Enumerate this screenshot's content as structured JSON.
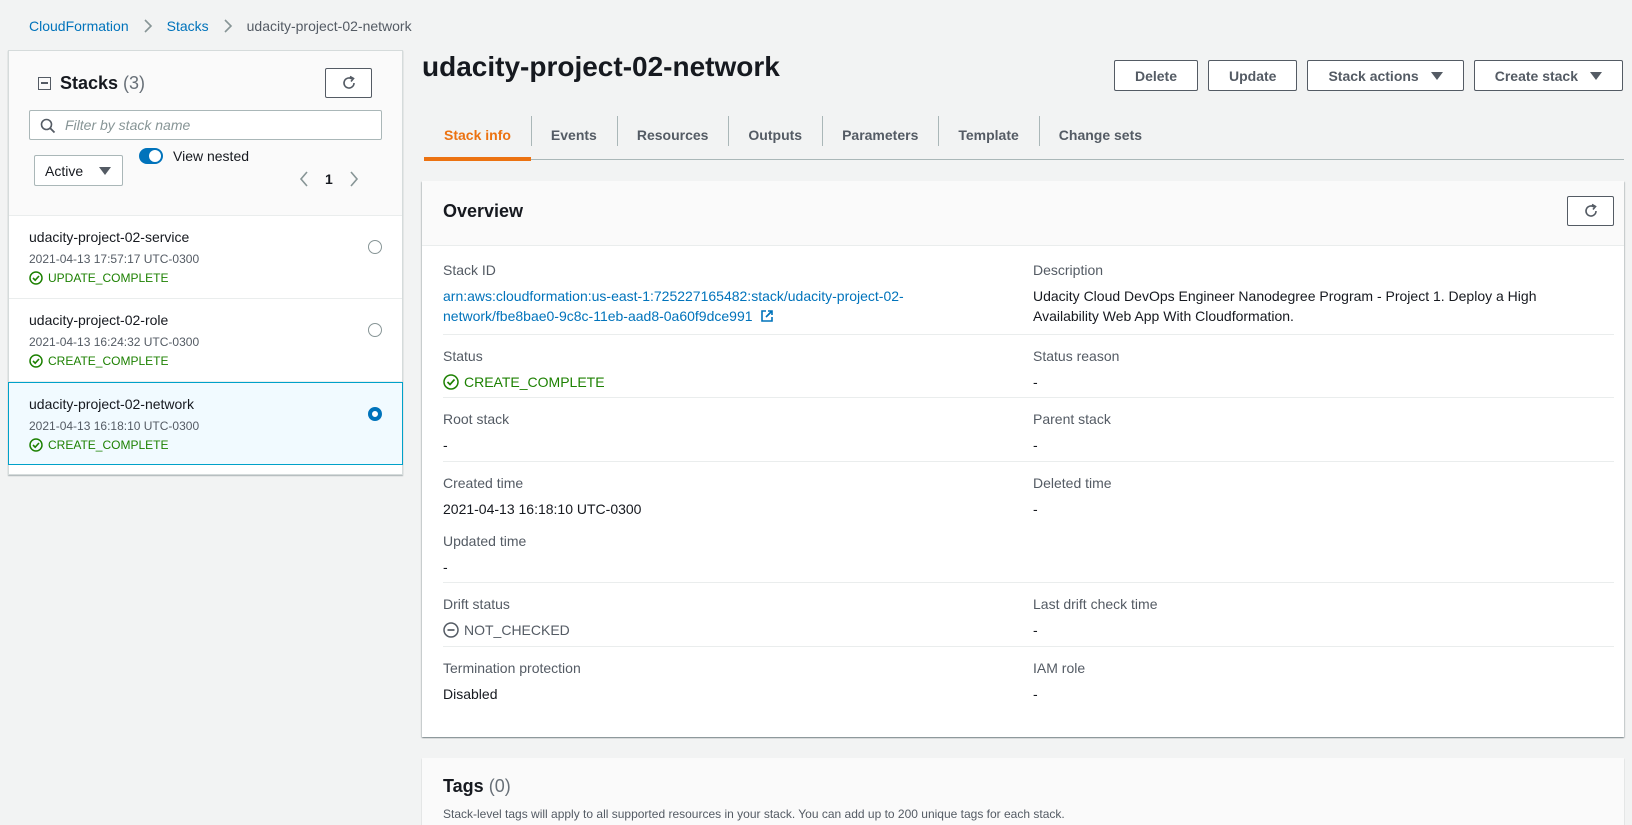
{
  "breadcrumb": {
    "root": "CloudFormation",
    "stacks": "Stacks",
    "current": "udacity-project-02-network"
  },
  "sidebar": {
    "title": "Stacks",
    "count": "(3)",
    "search_placeholder": "Filter by stack name",
    "filter_value": "Active",
    "view_nested_label": "View nested",
    "page": "1",
    "stacks": [
      {
        "name": "udacity-project-02-service",
        "date": "2021-04-13 17:57:17 UTC-0300",
        "status": "UPDATE_COMPLETE",
        "selected": false
      },
      {
        "name": "udacity-project-02-role",
        "date": "2021-04-13 16:24:32 UTC-0300",
        "status": "CREATE_COMPLETE",
        "selected": false
      },
      {
        "name": "udacity-project-02-network",
        "date": "2021-04-13 16:18:10 UTC-0300",
        "status": "CREATE_COMPLETE",
        "selected": true
      }
    ]
  },
  "main": {
    "title": "udacity-project-02-network",
    "actions": {
      "delete": "Delete",
      "update": "Update",
      "stack_actions": "Stack actions",
      "create_stack": "Create stack"
    },
    "tabs": [
      "Stack info",
      "Events",
      "Resources",
      "Outputs",
      "Parameters",
      "Template",
      "Change sets"
    ],
    "active_tab": "Stack info"
  },
  "overview": {
    "title": "Overview",
    "stack_id_label": "Stack ID",
    "stack_id_line1": "arn:aws:cloudformation:us-east-1:725227165482:stack/udacity-project-02-",
    "stack_id_line2": "network/fbe8bae0-9c8c-11eb-aad8-0a60f9dce991",
    "description_label": "Description",
    "description_line1": "Udacity Cloud DevOps Engineer Nanodegree Program - Project 1. Deploy a High",
    "description_line2": "Availability Web App With Cloudformation.",
    "status_label": "Status",
    "status_value": "CREATE_COMPLETE",
    "status_reason_label": "Status reason",
    "status_reason_value": "-",
    "root_stack_label": "Root stack",
    "root_stack_value": "-",
    "parent_stack_label": "Parent stack",
    "parent_stack_value": "-",
    "created_time_label": "Created time",
    "created_time_value": "2021-04-13 16:18:10 UTC-0300",
    "deleted_time_label": "Deleted time",
    "deleted_time_value": "-",
    "updated_time_label": "Updated time",
    "updated_time_value": "-",
    "drift_status_label": "Drift status",
    "drift_status_value": "NOT_CHECKED",
    "last_drift_label": "Last drift check time",
    "last_drift_value": "-",
    "termination_label": "Termination protection",
    "termination_value": "Disabled",
    "iam_role_label": "IAM role",
    "iam_role_value": "-"
  },
  "tags": {
    "title": "Tags",
    "count": "(0)",
    "description": "Stack-level tags will apply to all supported resources in your stack. You can add up to 200 unique tags for each stack."
  },
  "colors": {
    "link": "#0073bb",
    "active_tab": "#ec7211",
    "success": "#1d8102",
    "selected_border": "#00a1c9"
  }
}
